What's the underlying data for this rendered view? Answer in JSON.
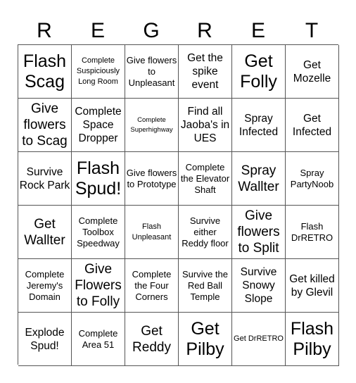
{
  "title_letters": [
    "R",
    "E",
    "G",
    "R",
    "E",
    "T"
  ],
  "board": [
    [
      {
        "text": "Flash Scag",
        "size": "xl"
      },
      {
        "text": "Complete Suspiciously Long Room",
        "size": "xs"
      },
      {
        "text": "Give flowers to Unpleasant",
        "size": "sm"
      },
      {
        "text": "Get the spike event",
        "size": "md"
      },
      {
        "text": "Get Folly",
        "size": "xl"
      },
      {
        "text": "Get Mozelle",
        "size": "md"
      }
    ],
    [
      {
        "text": "Give flowers to Scag",
        "size": "lg"
      },
      {
        "text": "Complete Space Dropper",
        "size": "md"
      },
      {
        "text": "Complete Superhighway",
        "size": "xxs"
      },
      {
        "text": "Find all Jaoba's in UES",
        "size": "md"
      },
      {
        "text": "Spray Infected",
        "size": "md"
      },
      {
        "text": "Get Infected",
        "size": "md"
      }
    ],
    [
      {
        "text": "Survive Rock Park",
        "size": "md"
      },
      {
        "text": "Flash Spud!",
        "size": "xl"
      },
      {
        "text": "Give flowers to Prototype",
        "size": "sm"
      },
      {
        "text": "Complete the Elevator Shaft",
        "size": "sm"
      },
      {
        "text": "Spray Wallter",
        "size": "lg"
      },
      {
        "text": "Spray PartyNoob",
        "size": "sm"
      }
    ],
    [
      {
        "text": "Get Wallter",
        "size": "lg"
      },
      {
        "text": "Complete Toolbox Speedway",
        "size": "sm"
      },
      {
        "text": "Flash Unpleasant",
        "size": "xs"
      },
      {
        "text": "Survive either Reddy floor",
        "size": "sm"
      },
      {
        "text": "Give flowers to Split",
        "size": "lg"
      },
      {
        "text": "Flash DrRETRO",
        "size": "sm"
      }
    ],
    [
      {
        "text": "Complete Jeremy's Domain",
        "size": "sm"
      },
      {
        "text": "Give Flowers to Folly",
        "size": "lg"
      },
      {
        "text": "Complete the Four Corners",
        "size": "sm"
      },
      {
        "text": "Survive the Red Ball Temple",
        "size": "sm"
      },
      {
        "text": "Survive Snowy Slope",
        "size": "md"
      },
      {
        "text": "Get killed by Glevil",
        "size": "md"
      }
    ],
    [
      {
        "text": "Explode Spud!",
        "size": "md"
      },
      {
        "text": "Complete Area 51",
        "size": "sm"
      },
      {
        "text": "Get Reddy",
        "size": "lg"
      },
      {
        "text": "Get Pilby",
        "size": "xl"
      },
      {
        "text": "Get DrRETRO",
        "size": "xs"
      },
      {
        "text": "Flash Pilby",
        "size": "xl"
      }
    ]
  ]
}
